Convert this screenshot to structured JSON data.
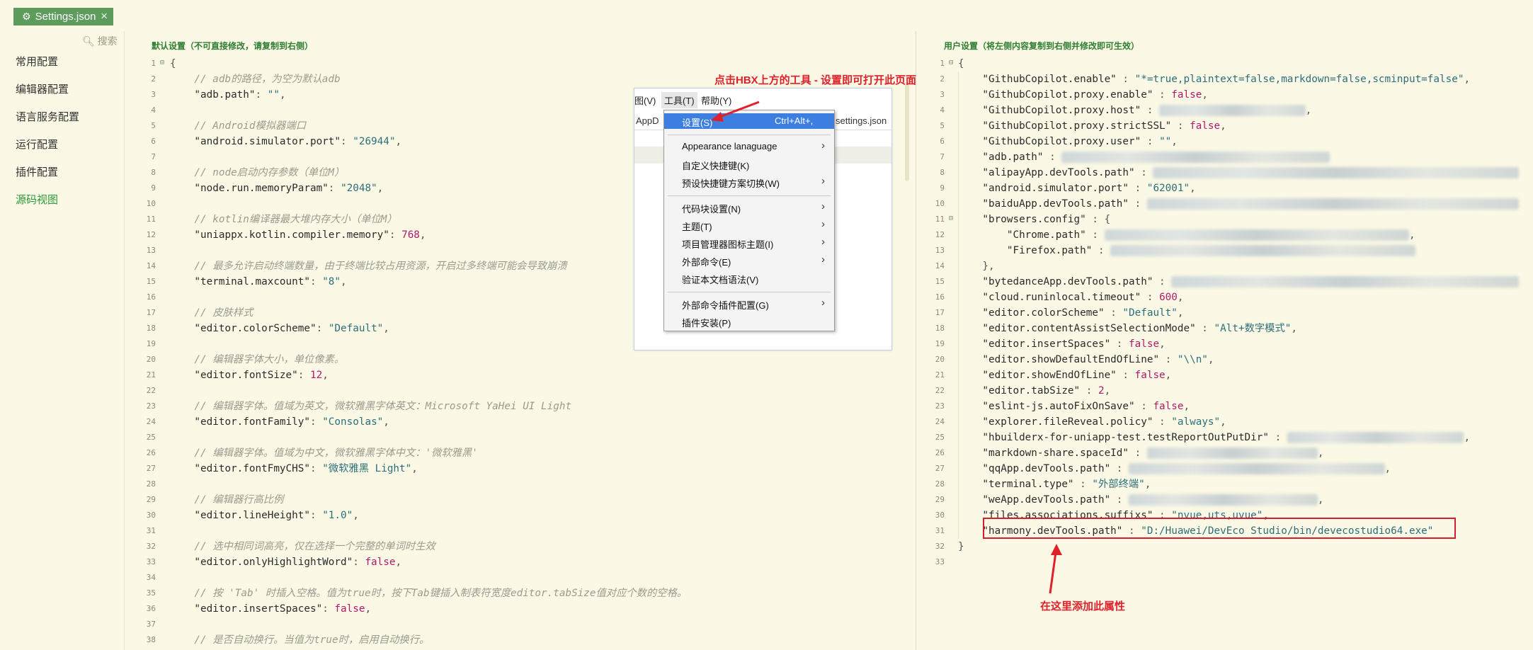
{
  "tab": {
    "title": "Settings.json",
    "gear": "⚙",
    "close": "×"
  },
  "nav": {
    "search": "搜索",
    "items": [
      {
        "label": "常用配置"
      },
      {
        "label": "编辑器配置"
      },
      {
        "label": "语言服务配置"
      },
      {
        "label": "运行配置"
      },
      {
        "label": "插件配置"
      },
      {
        "label": "源码视图",
        "active": true
      }
    ]
  },
  "left_pane": {
    "title": "默认设置（不可直接修改，请复制到右侧）",
    "lines": [
      [
        [
          "p",
          "{"
        ]
      ],
      [
        [
          "c",
          "    // adb的路径，为空为默认adb"
        ]
      ],
      [
        [
          "k",
          "    \"adb.path\""
        ],
        [
          "p",
          ": "
        ],
        [
          "s",
          "\"\""
        ],
        [
          "p",
          ","
        ]
      ],
      [],
      [
        [
          "c",
          "    // Android模拟器端口"
        ]
      ],
      [
        [
          "k",
          "    \"android.simulator.port\""
        ],
        [
          "p",
          ": "
        ],
        [
          "s",
          "\"26944\""
        ],
        [
          "p",
          ","
        ]
      ],
      [],
      [
        [
          "c",
          "    // node启动内存参数（单位M）"
        ]
      ],
      [
        [
          "k",
          "    \"node.run.memoryParam\""
        ],
        [
          "p",
          ": "
        ],
        [
          "s",
          "\"2048\""
        ],
        [
          "p",
          ","
        ]
      ],
      [],
      [
        [
          "c",
          "    // kotlin编译器最大堆内存大小（单位M）"
        ]
      ],
      [
        [
          "k",
          "    \"uniappx.kotlin.compiler.memory\""
        ],
        [
          "p",
          ": "
        ],
        [
          "n",
          "768"
        ],
        [
          "p",
          ","
        ]
      ],
      [],
      [
        [
          "c",
          "    // 最多允许启动终端数量，由于终端比较占用资源，开启过多终端可能会导致崩溃"
        ]
      ],
      [
        [
          "k",
          "    \"terminal.maxcount\""
        ],
        [
          "p",
          ": "
        ],
        [
          "s",
          "\"8\""
        ],
        [
          "p",
          ","
        ]
      ],
      [],
      [
        [
          "c",
          "    // 皮肤样式"
        ]
      ],
      [
        [
          "k",
          "    \"editor.colorScheme\""
        ],
        [
          "p",
          ": "
        ],
        [
          "s",
          "\"Default\""
        ],
        [
          "p",
          ","
        ]
      ],
      [],
      [
        [
          "c",
          "    // 编辑器字体大小，单位像素。"
        ]
      ],
      [
        [
          "k",
          "    \"editor.fontSize\""
        ],
        [
          "p",
          ": "
        ],
        [
          "n",
          "12"
        ],
        [
          "p",
          ","
        ]
      ],
      [],
      [
        [
          "c",
          "    // 编辑器字体。值域为英文，微软雅黑字体英文：Microsoft YaHei UI Light"
        ]
      ],
      [
        [
          "k",
          "    \"editor.fontFamily\""
        ],
        [
          "p",
          ": "
        ],
        [
          "s",
          "\"Consolas\""
        ],
        [
          "p",
          ","
        ]
      ],
      [],
      [
        [
          "c",
          "    // 编辑器字体。值域为中文，微软雅黑字体中文：'微软雅黑'"
        ]
      ],
      [
        [
          "k",
          "    \"editor.fontFmyCHS\""
        ],
        [
          "p",
          ": "
        ],
        [
          "s",
          "\"微软雅黑 Light\""
        ],
        [
          "p",
          ","
        ]
      ],
      [],
      [
        [
          "c",
          "    // 编辑器行高比例"
        ]
      ],
      [
        [
          "k",
          "    \"editor.lineHeight\""
        ],
        [
          "p",
          ": "
        ],
        [
          "s",
          "\"1.0\""
        ],
        [
          "p",
          ","
        ]
      ],
      [],
      [
        [
          "c",
          "    // 选中相同词高亮，仅在选择一个完整的单词时生效"
        ]
      ],
      [
        [
          "k",
          "    \"editor.onlyHighlightWord\""
        ],
        [
          "p",
          ": "
        ],
        [
          "b",
          "false"
        ],
        [
          "p",
          ","
        ]
      ],
      [],
      [
        [
          "c",
          "    // 按 'Tab' 时插入空格。值为true时，按下Tab键插入制表符宽度editor.tabSize值对应个数的空格。"
        ]
      ],
      [
        [
          "k",
          "    \"editor.insertSpaces\""
        ],
        [
          "p",
          ": "
        ],
        [
          "b",
          "false"
        ],
        [
          "p",
          ","
        ]
      ],
      [],
      [
        [
          "c",
          "    // 是否自动换行。当值为true时，启用自动换行。"
        ]
      ]
    ]
  },
  "right_pane": {
    "title": "用户设置（将左侧内容复制到右侧并修改即可生效）",
    "lines": [
      [
        [
          "p",
          "{"
        ]
      ],
      [
        [
          "k",
          "    \"GithubCopilot.enable\""
        ],
        [
          "p",
          " : "
        ],
        [
          "s",
          "\"*=true,plaintext=false,markdown=false,scminput=false\""
        ],
        [
          "p",
          ","
        ]
      ],
      [
        [
          "k",
          "    \"GithubCopilot.proxy.enable\""
        ],
        [
          "p",
          " : "
        ],
        [
          "b",
          "false"
        ],
        [
          "p",
          ","
        ]
      ],
      [
        [
          "k",
          "    \"GithubCopilot.proxy.host\""
        ],
        [
          "p",
          " : "
        ],
        [
          "x",
          "\"xxxxxxxxxxxxxxxxxxxxxx\""
        ],
        [
          "p",
          ","
        ]
      ],
      [
        [
          "k",
          "    \"GithubCopilot.proxy.strictSSL\""
        ],
        [
          "p",
          " : "
        ],
        [
          "b",
          "false"
        ],
        [
          "p",
          ","
        ]
      ],
      [
        [
          "k",
          "    \"GithubCopilot.proxy.user\""
        ],
        [
          "p",
          " : "
        ],
        [
          "s",
          "\"\""
        ],
        [
          "p",
          ","
        ]
      ],
      [
        [
          "k",
          "    \"adb.path\""
        ],
        [
          "p",
          " : "
        ],
        [
          "x",
          "\"xxxxxxxxxxxxxxxxxxxxxxxxxxxxxxxxxxxxxxxxxx\""
        ]
      ],
      [
        [
          "k",
          "    \"alipayApp.devTools.path\""
        ],
        [
          "p",
          " : "
        ],
        [
          "x",
          "\"xxxxxxxxxxxxxxxxxxxxxxxxxxxxxxxxxxxxxxxxxxxxxxxxxxxxxxxxxx\""
        ]
      ],
      [
        [
          "k",
          "    \"android.simulator.port\""
        ],
        [
          "p",
          " : "
        ],
        [
          "s",
          "\"62001\""
        ],
        [
          "p",
          ","
        ]
      ],
      [
        [
          "k",
          "    \"baiduApp.devTools.path\""
        ],
        [
          "p",
          " : "
        ],
        [
          "x",
          "\"xxxxxxxxxxxxxxxxxxxxxxxxxxxxxxxxxxxxxxxxxxxxxxxxxxxxxxxxxxx\""
        ]
      ],
      [
        [
          "k",
          "    \"browsers.config\""
        ],
        [
          "p",
          " : {"
        ]
      ],
      [
        [
          "k",
          "        \"Chrome.path\""
        ],
        [
          "p",
          " : "
        ],
        [
          "x",
          "\"xxxxxxxxxxxxxxxxxxxxxxxxxxxxxxxxxxxxxxxxxxxxxxxx\""
        ],
        [
          "p",
          ","
        ]
      ],
      [
        [
          "k",
          "        \"Firefox.path\""
        ],
        [
          "p",
          " : "
        ],
        [
          "x",
          "\"xxxxxxxxxxxxxxxxxxxxxxxxxxxxxxxxxxxxxxxxxxxxxxxx\""
        ]
      ],
      [
        [
          "p",
          "    },"
        ]
      ],
      [
        [
          "k",
          "    \"bytedanceApp.devTools.path\""
        ],
        [
          "p",
          " : "
        ],
        [
          "x",
          "\"xxxxxxxxxxxxxxxxxxxxxxxxxxxxxxxxxxxxxxxxxxxxxxxxxxxxxxx\""
        ]
      ],
      [
        [
          "k",
          "    \"cloud.runinlocal.timeout\""
        ],
        [
          "p",
          " : "
        ],
        [
          "n",
          "600"
        ],
        [
          "p",
          ","
        ]
      ],
      [
        [
          "k",
          "    \"editor.colorScheme\""
        ],
        [
          "p",
          " : "
        ],
        [
          "s",
          "\"Default\""
        ],
        [
          "p",
          ","
        ]
      ],
      [
        [
          "k",
          "    \"editor.contentAssistSelectionMode\""
        ],
        [
          "p",
          " : "
        ],
        [
          "s",
          "\"Alt+数字模式\""
        ],
        [
          "p",
          ","
        ]
      ],
      [
        [
          "k",
          "    \"editor.insertSpaces\""
        ],
        [
          "p",
          " : "
        ],
        [
          "b",
          "false"
        ],
        [
          "p",
          ","
        ]
      ],
      [
        [
          "k",
          "    \"editor.showDefaultEndOfLine\""
        ],
        [
          "p",
          " : "
        ],
        [
          "s",
          "\"\\\\n\""
        ],
        [
          "p",
          ","
        ]
      ],
      [
        [
          "k",
          "    \"editor.showEndOfLine\""
        ],
        [
          "p",
          " : "
        ],
        [
          "b",
          "false"
        ],
        [
          "p",
          ","
        ]
      ],
      [
        [
          "k",
          "    \"editor.tabSize\""
        ],
        [
          "p",
          " : "
        ],
        [
          "n",
          "2"
        ],
        [
          "p",
          ","
        ]
      ],
      [
        [
          "k",
          "    \"eslint-js.autoFixOnSave\""
        ],
        [
          "p",
          " : "
        ],
        [
          "b",
          "false"
        ],
        [
          "p",
          ","
        ]
      ],
      [
        [
          "k",
          "    \"explorer.fileReveal.policy\""
        ],
        [
          "p",
          " : "
        ],
        [
          "s",
          "\"always\""
        ],
        [
          "p",
          ","
        ]
      ],
      [
        [
          "k",
          "    \"hbuilderx-for-uniapp-test.testReportOutPutDir\""
        ],
        [
          "p",
          " : "
        ],
        [
          "x",
          "\"xxxxxxxxxxxxxxxxxxxxxxxxxxx\""
        ],
        [
          "p",
          ","
        ]
      ],
      [
        [
          "k",
          "    \"markdown-share.spaceId\""
        ],
        [
          "p",
          " : "
        ],
        [
          "x",
          "\"xxxxxxxxxxxxxxxxxxxxxxxxxx\""
        ],
        [
          "p",
          ","
        ]
      ],
      [
        [
          "k",
          "    \"qqApp.devTools.path\""
        ],
        [
          "p",
          " : "
        ],
        [
          "x",
          "\"xxxxxxxxxxxxxxxxxxxxxxxxxxxxxxxxxxxxxxxx\""
        ],
        [
          "p",
          ","
        ]
      ],
      [
        [
          "k",
          "    \"terminal.type\""
        ],
        [
          "p",
          " : "
        ],
        [
          "s",
          "\"外部终端\""
        ],
        [
          "p",
          ","
        ]
      ],
      [
        [
          "k",
          "    \"weApp.devTools.path\""
        ],
        [
          "p",
          " : "
        ],
        [
          "x",
          "\"xxxxxxxxxxxxxxxxxxxxxxxxxxxxx\""
        ],
        [
          "p",
          ","
        ]
      ],
      [
        [
          "k",
          "    \"files.associations.suffixs\""
        ],
        [
          "p",
          " : "
        ],
        [
          "s",
          "\"nvue,uts,uvue\""
        ],
        [
          "p",
          ","
        ]
      ],
      [
        [
          "k",
          "    \"harmony.devTools.path\""
        ],
        [
          "p",
          " : "
        ],
        [
          "s",
          "\"D:/Huawei/DevEco Studio/bin/devecostudio64.exe\""
        ]
      ],
      [
        [
          "p",
          "}"
        ]
      ],
      []
    ]
  },
  "popup": {
    "menubar": [
      {
        "label": "图(V)"
      },
      {
        "label": "工具(T)",
        "selected": true
      },
      {
        "label": "帮助(Y)"
      }
    ],
    "tabs_left": "AppD",
    "tabs_right": "settings.json",
    "menu": [
      {
        "label": "设置(S)",
        "shortcut": "Ctrl+Alt+,",
        "highlight": true
      },
      {
        "sep": true
      },
      {
        "label": "Appearance lanaguage",
        "submenu": true
      },
      {
        "label": "自定义快捷键(K)"
      },
      {
        "label": "预设快捷键方案切换(W)",
        "submenu": true
      },
      {
        "sep": true
      },
      {
        "label": "代码块设置(N)",
        "submenu": true
      },
      {
        "label": "主题(T)",
        "submenu": true
      },
      {
        "label": "项目管理器图标主题(I)",
        "submenu": true
      },
      {
        "label": "外部命令(E)",
        "submenu": true
      },
      {
        "label": "验证本文档语法(V)"
      },
      {
        "sep": true
      },
      {
        "label": "外部命令插件配置(G)",
        "submenu": true
      },
      {
        "label": "插件安装(P)"
      }
    ],
    "arrow_glyph": "›"
  },
  "annotations": {
    "top": "点击HBX上方的工具 - 设置即可打开此页面",
    "bottom": "在这里添加此属性"
  },
  "colors": {
    "accent": "#5e9c5e",
    "annotation": "#e0202a",
    "highlight": "#3d7fe0"
  }
}
